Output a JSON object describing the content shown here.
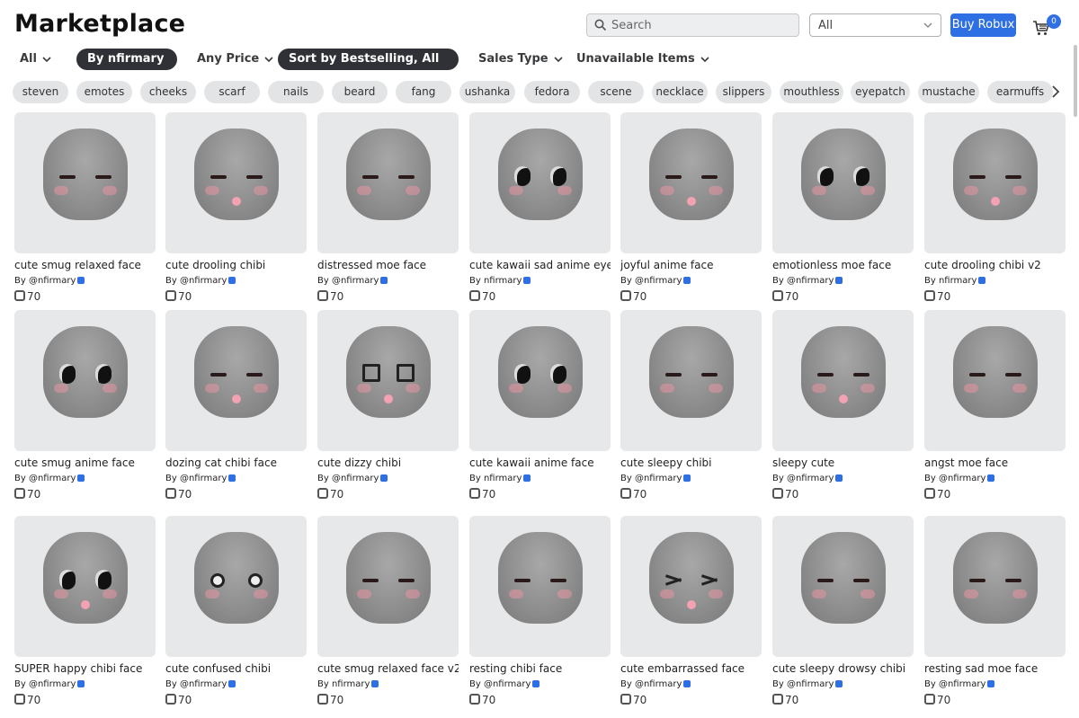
{
  "header": {
    "title": "Marketplace",
    "search_placeholder": "Search",
    "category_select": "All",
    "buy_button": "Buy Robux",
    "cart_count": "0"
  },
  "filters": {
    "category": "All",
    "creator_pill": "By nfirmary",
    "price": "Any Price",
    "sort_pill": "Sort by Bestselling, All Time",
    "sales_type": "Sales Type",
    "unavailable": "Unavailable Items"
  },
  "tags": [
    "steven",
    "emotes",
    "cheeks",
    "scarf",
    "nails",
    "beard",
    "fang",
    "ushanka",
    "fedora",
    "scene",
    "necklace",
    "slippers",
    "mouthless",
    "eyepatch",
    "mustache",
    "earmuffs"
  ],
  "items": [
    {
      "name": "cute smug relaxed face",
      "creator": "@nfirmary",
      "by": "By",
      "price": "70",
      "eyes": "closed",
      "tongue": false
    },
    {
      "name": "cute drooling chibi",
      "creator": "@nfirmary",
      "by": "By",
      "price": "70",
      "eyes": "closed",
      "tongue": true
    },
    {
      "name": "distressed moe face",
      "creator": "@nfirmary",
      "by": "By",
      "price": "70",
      "eyes": "closed",
      "tongue": false
    },
    {
      "name": "cute kawaii sad anime eyes",
      "creator": "nfirmary",
      "by": "By",
      "price": "70",
      "eyes": "big",
      "tongue": false
    },
    {
      "name": "joyful anime face",
      "creator": "@nfirmary",
      "by": "By",
      "price": "70",
      "eyes": "closed",
      "tongue": true
    },
    {
      "name": "emotionless moe face",
      "creator": "@nfirmary",
      "by": "By",
      "price": "70",
      "eyes": "big",
      "tongue": false
    },
    {
      "name": "cute drooling chibi v2",
      "creator": "nfirmary",
      "by": "By",
      "price": "70",
      "eyes": "closed",
      "tongue": true
    },
    {
      "name": "cute smug anime face",
      "creator": "@nfirmary",
      "by": "By",
      "price": "70",
      "eyes": "big",
      "tongue": false
    },
    {
      "name": "dozing cat chibi face",
      "creator": "@nfirmary",
      "by": "By",
      "price": "70",
      "eyes": "closed",
      "tongue": true
    },
    {
      "name": "cute dizzy chibi",
      "creator": "@nfirmary",
      "by": "By",
      "price": "70",
      "eyes": "sq",
      "tongue": true
    },
    {
      "name": "cute kawaii anime face",
      "creator": "nfirmary",
      "by": "By",
      "price": "70",
      "eyes": "big",
      "tongue": false
    },
    {
      "name": "cute sleepy chibi",
      "creator": "@nfirmary",
      "by": "By",
      "price": "70",
      "eyes": "closed",
      "tongue": false
    },
    {
      "name": "sleepy cute",
      "creator": "@nfirmary",
      "by": "By",
      "price": "70",
      "eyes": "closed",
      "tongue": true
    },
    {
      "name": "angst moe face",
      "creator": "@nfirmary",
      "by": "By",
      "price": "70",
      "eyes": "closed",
      "tongue": false
    },
    {
      "name": "SUPER happy chibi face",
      "creator": "@nfirmary",
      "by": "By",
      "price": "70",
      "eyes": "big",
      "tongue": true
    },
    {
      "name": "cute confused chibi",
      "creator": "@nfirmary",
      "by": "By",
      "price": "70",
      "eyes": "ring",
      "tongue": false
    },
    {
      "name": "cute smug relaxed face v2",
      "creator": "nfirmary",
      "by": "By",
      "price": "70",
      "eyes": "closed",
      "tongue": false
    },
    {
      "name": "resting chibi face",
      "creator": "@nfirmary",
      "by": "By",
      "price": "70",
      "eyes": "closed",
      "tongue": false
    },
    {
      "name": "cute embarrassed face",
      "creator": "@nfirmary",
      "by": "By",
      "price": "70",
      "eyes": "x",
      "tongue": true
    },
    {
      "name": "cute sleepy drowsy chibi",
      "creator": "@nfirmary",
      "by": "By",
      "price": "70",
      "eyes": "closed",
      "tongue": false
    },
    {
      "name": "resting sad moe face",
      "creator": "@nfirmary",
      "by": "By",
      "price": "70",
      "eyes": "closed",
      "tongue": false
    }
  ],
  "colors": {
    "accent": "#2f6fe4",
    "pill_dark": "#2f3136",
    "tag_bg": "#e3e4e6",
    "thumb_bg": "#e7e8ea"
  }
}
